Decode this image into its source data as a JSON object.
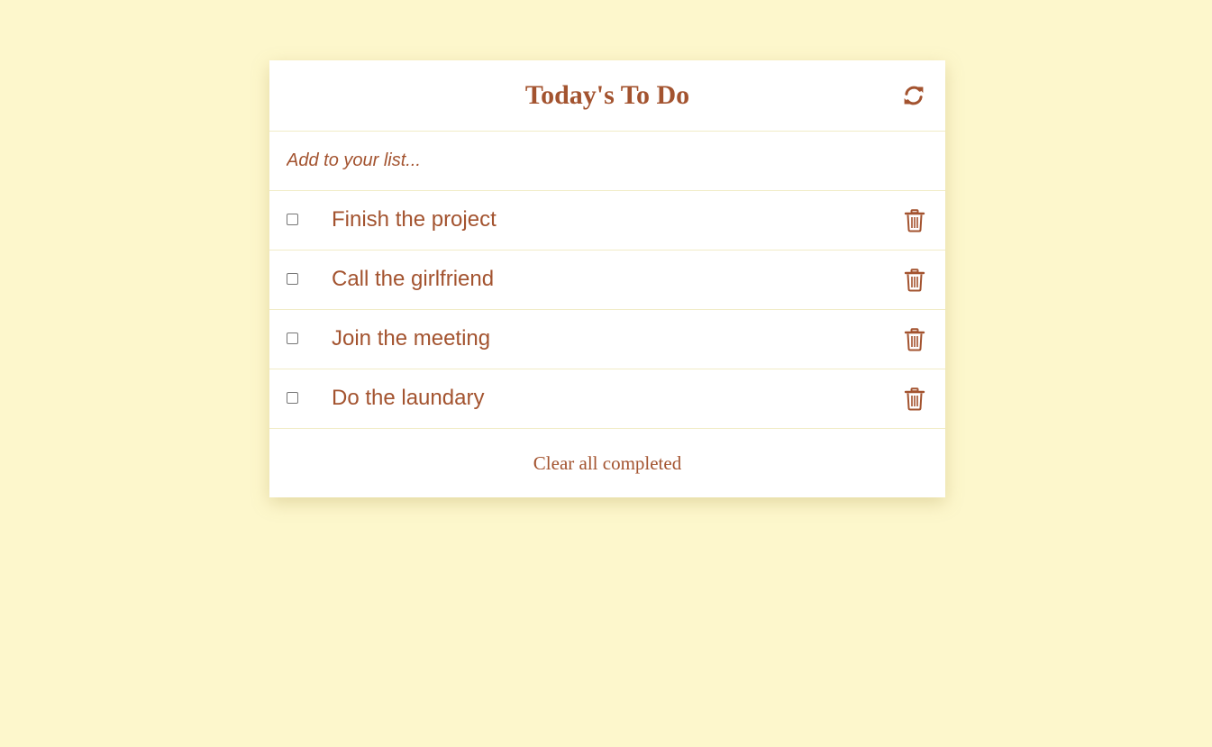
{
  "header": {
    "title": "Today's To Do",
    "refresh_icon": "refresh-icon"
  },
  "new_item": {
    "placeholder": "Add to your list...",
    "value": ""
  },
  "todos": [
    {
      "text": "Finish the project",
      "completed": false
    },
    {
      "text": "Call the girlfriend",
      "completed": false
    },
    {
      "text": "Join the meeting",
      "completed": false
    },
    {
      "text": "Do the laundary",
      "completed": false
    }
  ],
  "item_icons": {
    "delete": "trash-icon"
  },
  "footer": {
    "clear_label": "Clear all completed"
  },
  "colors": {
    "background": "#fdf7cc",
    "accent": "#a3532f",
    "card": "#ffffff",
    "divider": "#f1ecc7"
  }
}
